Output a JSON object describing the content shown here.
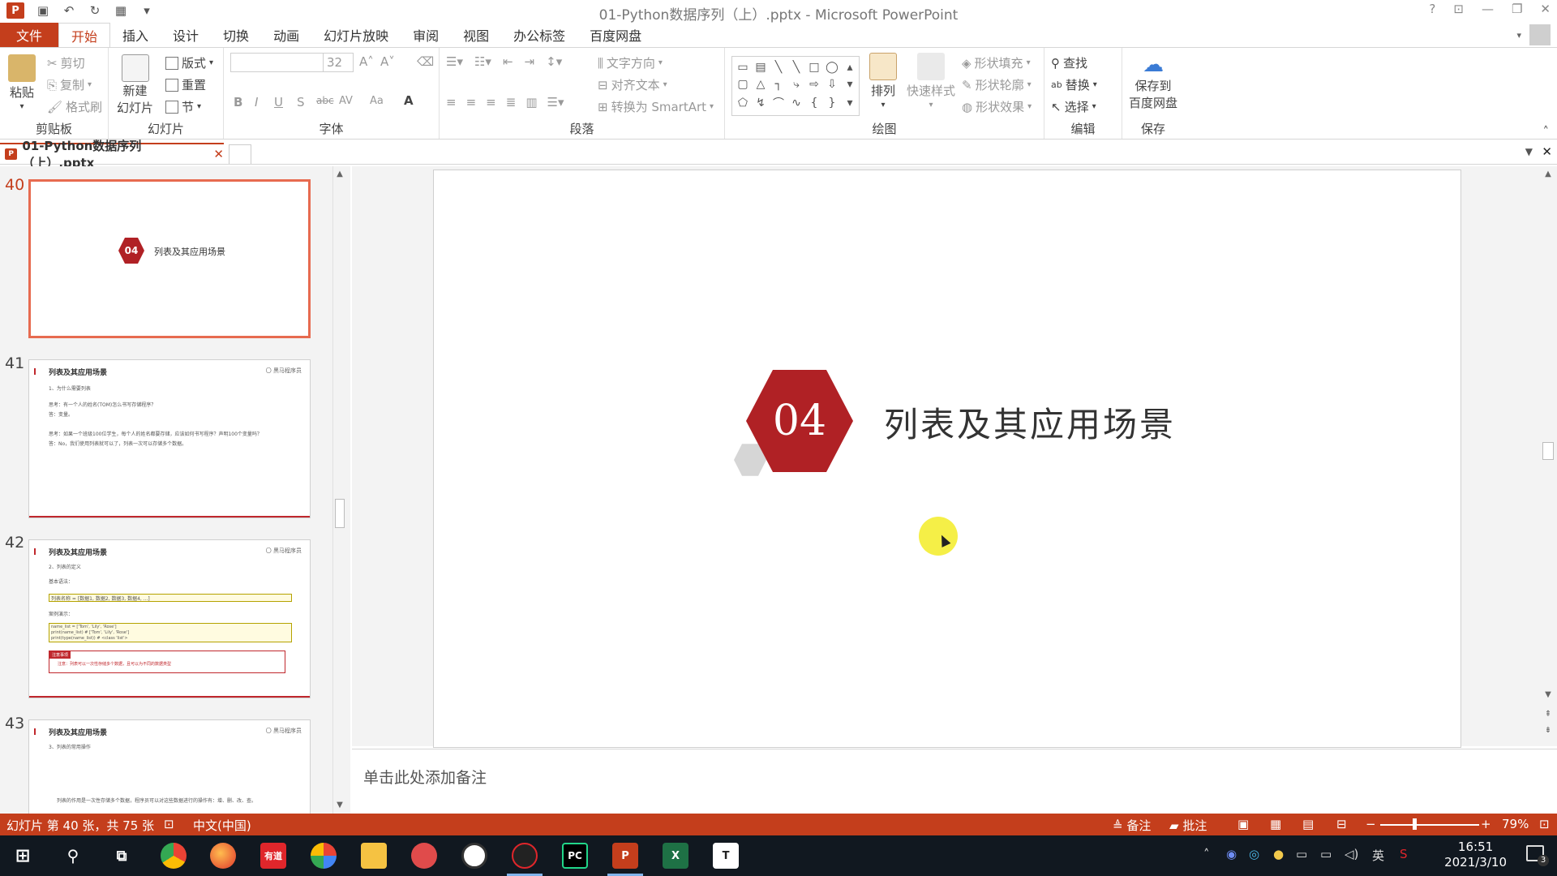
{
  "window": {
    "title": "01-Python数据序列（上）.pptx - Microsoft PowerPoint",
    "app_logo": "P",
    "help_icon": "?",
    "controls": [
      "—",
      "❐",
      "✕"
    ]
  },
  "quick_access": {
    "icons": [
      "save-icon",
      "undo-icon",
      "redo-icon",
      "present-icon"
    ]
  },
  "tabs": {
    "file": "文件",
    "items": [
      "开始",
      "插入",
      "设计",
      "切换",
      "动画",
      "幻灯片放映",
      "审阅",
      "视图",
      "办公标签",
      "百度网盘"
    ],
    "active": "开始"
  },
  "ribbon": {
    "clipboard": {
      "label": "剪贴板",
      "paste": "粘贴",
      "cut": "剪切",
      "copy": "复制",
      "format_painter": "格式刷"
    },
    "slides": {
      "label": "幻灯片",
      "new_slide_line1": "新建",
      "new_slide_line2": "幻灯片",
      "layout": "版式",
      "reset": "重置",
      "section": "节"
    },
    "font": {
      "label": "字体",
      "font_name": "",
      "font_size": "32",
      "buttons": [
        "B",
        "I",
        "U",
        "abc",
        "S",
        "AV",
        "Aa",
        "A"
      ]
    },
    "paragraph": {
      "label": "段落",
      "text_direction": "文字方向",
      "align_text": "对齐文本",
      "smartart": "转换为 SmartArt"
    },
    "drawing": {
      "label": "绘图",
      "arrange": "排列",
      "quick_styles": "快速样式",
      "shape_fill": "形状填充",
      "shape_outline": "形状轮廓",
      "shape_effects": "形状效果",
      "shapes": [
        "▭",
        "▤",
        "╲",
        "╲",
        "□",
        "◯",
        "▴",
        "▢",
        "△",
        "┐",
        "⤷",
        "⇨",
        "⇩",
        "▾",
        "⬠",
        "↯",
        "⌒",
        "∿",
        "{",
        "}",
        "▾"
      ]
    },
    "editing": {
      "label": "编辑",
      "find": "查找",
      "replace": "替换",
      "select": "选择"
    },
    "save": {
      "label": "保存",
      "save_to_line1": "保存到",
      "save_to_line2": "百度网盘"
    }
  },
  "document_tab": {
    "name": "01-Python数据序列（上）.pptx",
    "close": "✕"
  },
  "thumbnails": [
    {
      "number": "40",
      "active": true,
      "badge": "04",
      "title": "列表及其应用场景"
    },
    {
      "number": "41",
      "active": false,
      "title": "列表及其应用场景",
      "logo": "〇 黑马程序员",
      "lines": [
        "1、为什么需要列表",
        "思考：有一个人的姓名(TOM)怎么书写存储程序？",
        "答：变量。",
        "思考：如果一个班级100位学生，每个人的姓名都要存储，应该如何书写程序？声明100个变量吗？",
        "答：No，我们使用列表就可以了，列表一次可以存储多个数据。"
      ]
    },
    {
      "number": "42",
      "active": false,
      "title": "列表及其应用场景",
      "logo": "〇 黑马程序员",
      "lines": [
        "2、列表的定义",
        "基本语法：",
        "列表名称 = [数据1, 数据2, 数据3, 数据4, ...]",
        "案例演示：",
        "name_list = ['Tom', 'Lily', 'Rose']",
        "print(name_list)      # ['Tom', 'Lily', 'Rose']",
        "print(type(name_list)) # <class 'list'>",
        "注意事项",
        "注意：列表可以一次性存储多个数据，且可以为不同的数据类型"
      ]
    },
    {
      "number": "43",
      "active": false,
      "title": "列表及其应用场景",
      "logo": "〇 黑马程序员",
      "lines": [
        "3、列表的常用操作",
        "列表的作用是一次性存储多个数据，程序员可以对这些数据进行的操作有：增、删、改、查。"
      ]
    }
  ],
  "slide": {
    "badge": "04",
    "title": "列表及其应用场景",
    "badge_color": "#b02125"
  },
  "notes": {
    "placeholder": "单击此处添加备注"
  },
  "status_bar": {
    "slide_info": "幻灯片 第 40 张，共 75 张",
    "language": "中文(中国)",
    "notes": "备注",
    "comments": "批注",
    "zoom": "79%",
    "zoom_level": 0.33,
    "accent": "#c43e1c"
  },
  "taskbar": {
    "apps": [
      "start-icon",
      "search-icon",
      "task-view-icon",
      "chrome-icon",
      "firefox-icon",
      "youdao-icon",
      "browser-icon",
      "explorer-icon",
      "app-icon",
      "app-icon-2",
      "recorder-icon",
      "pycharm-icon",
      "powerpoint-icon",
      "excel-icon",
      "typora-icon"
    ],
    "youdao_label": "有道",
    "pycharm_label": "PC",
    "ppt_label": "P",
    "excel_label": "X",
    "typora_label": "T",
    "ime": "英",
    "time": "16:51",
    "date": "2021/3/10",
    "notification_count": "3"
  }
}
